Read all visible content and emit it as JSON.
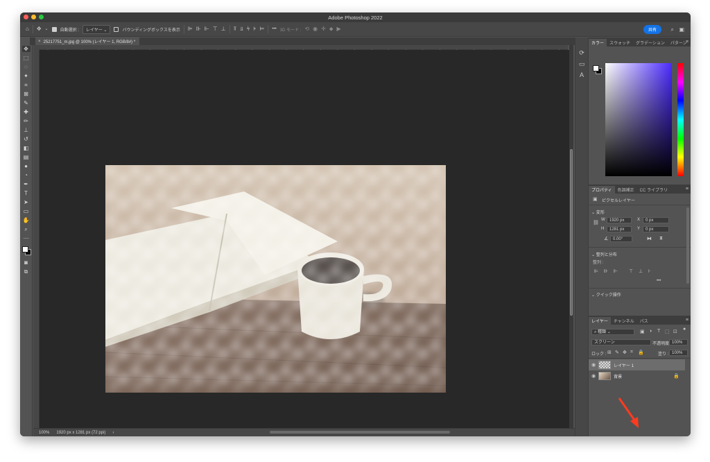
{
  "app": {
    "title": "Adobe Photoshop 2022"
  },
  "colors": {
    "accent": "#1473e6",
    "arrow": "#ff3b1f"
  },
  "options_bar": {
    "auto_select_label": "自動選択 :",
    "auto_select_target": "レイヤー",
    "bounding_box_label": "バウンディングボックスを表示",
    "more_label": "•••",
    "mode_3d_label": "3D モード :",
    "share_label": "共有"
  },
  "document": {
    "tab_label": "25217751_m.jpg @ 100% (レイヤー 1, RGB/8#) *"
  },
  "ruler": {
    "top_ticks": [
      "300",
      "200",
      "100",
      "0",
      "100",
      "200",
      "300",
      "400",
      "500",
      "600",
      "700",
      "800",
      "900",
      "1000",
      "1100",
      "1200",
      "1300",
      "1400",
      "1500",
      "1600",
      "1700",
      "1800",
      "1900",
      "2000",
      "2100",
      "2200",
      "2300",
      "2400",
      "2500",
      "2600",
      "27"
    ]
  },
  "status": {
    "zoom": "100%",
    "doc_info": "1920 px x 1281 px (72 ppi)",
    "arrow": "›"
  },
  "color_panel": {
    "tabs": [
      "カラー",
      "スウォッチ",
      "グラデーション",
      "パターン"
    ]
  },
  "properties_panel": {
    "tabs": [
      "プロパティ",
      "色調補正",
      "CC ライブラリ"
    ],
    "layer_kind": "ピクセルレイヤー",
    "transform_title": "変形",
    "w_label": "W",
    "w_value": "1920 px",
    "h_label": "H",
    "h_value": "1281 px",
    "x_label": "X",
    "x_value": "0 px",
    "y_label": "Y",
    "y_value": "0 px",
    "angle_value": "0.00°",
    "align_title": "整列と分布",
    "align_label": "整列 :",
    "more_label": "•••",
    "quick_actions_title": "クイック操作"
  },
  "layers_panel": {
    "tabs": [
      "レイヤー",
      "チャンネル",
      "パス"
    ],
    "filter_kind": "種類",
    "blend_mode": "スクリーン",
    "opacity_label": "不透明度 :",
    "opacity_value": "100%",
    "lock_label": "ロック :",
    "fill_label": "塗り :",
    "fill_value": "100%",
    "layers": [
      {
        "name": "レイヤー 1",
        "selected": true
      },
      {
        "name": "背景",
        "selected": false,
        "locked": true
      }
    ]
  }
}
